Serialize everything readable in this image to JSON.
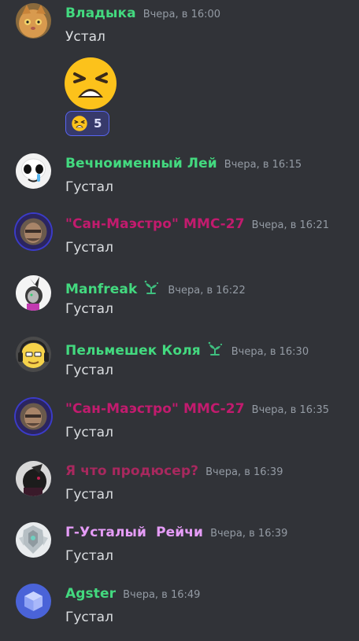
{
  "messages": [
    {
      "username": "Владыка",
      "name_color": "#43d97f",
      "timestamp": "Вчера, в 16:00",
      "text": "Устал",
      "big_emoji": "tired-face-emoji",
      "reaction": {
        "emoji": "tired-face-emoji",
        "count": "5"
      },
      "avatar_icon": "cat-avatar"
    },
    {
      "username": "Вечноименный Лей",
      "name_color": "#43d97f",
      "timestamp": "Вчера, в 16:15",
      "text": "Густал",
      "avatar_icon": "skull-avatar"
    },
    {
      "username": "\"Сан-Маэстро\" ММС-27",
      "name_color": "#c21b6e",
      "timestamp": "Вчера, в 16:21",
      "text": "Густал",
      "avatar_icon": "portrait-avatar"
    },
    {
      "username": "Manfreak",
      "name_color": "#43d97f",
      "timestamp": "Вчера, в 16:22",
      "text": "Густал",
      "badge": "sprout-badge-icon",
      "avatar_icon": "character-avatar"
    },
    {
      "username": "Пельмешек Коля",
      "name_color": "#43d97f",
      "timestamp": "Вчера, в 16:30",
      "text": "Густал",
      "badge": "sprout-badge-icon",
      "avatar_icon": "headphones-avatar"
    },
    {
      "username": "\"Сан-Маэстро\" ММС-27",
      "name_color": "#c21b6e",
      "timestamp": "Вчера, в 16:35",
      "text": "Густал",
      "avatar_icon": "portrait-avatar"
    },
    {
      "username": "Я что продюсер?",
      "name_color": "#a8285e",
      "timestamp": "Вчера, в 16:39",
      "text": "Густал",
      "avatar_icon": "dark-creature-avatar"
    },
    {
      "username": "Г-Усталый  Рейчи",
      "name_color": "#e59cf7",
      "timestamp": "Вчера, в 16:39",
      "text": "Густал",
      "avatar_icon": "robot-avatar"
    },
    {
      "username": "Agster",
      "name_color": "#43d97f",
      "timestamp": "Вчера, в 16:49",
      "text": "Густал",
      "avatar_icon": "cube-avatar"
    }
  ]
}
